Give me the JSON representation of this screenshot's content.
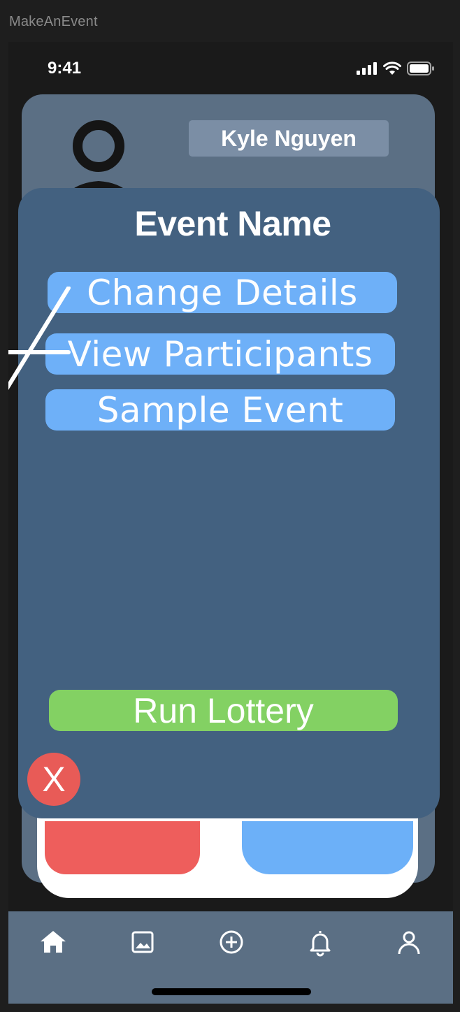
{
  "app": {
    "frame_title": "MakeAnEvent"
  },
  "status_bar": {
    "time": "9:41",
    "icons": [
      "cellular-signal-icon",
      "wifi-icon",
      "battery-icon"
    ]
  },
  "profile": {
    "name": "Kyle Nguyen"
  },
  "popup": {
    "title": "Event Name",
    "buttons": {
      "change_details": "Change Details",
      "view_participants": "View Participants",
      "sample_event": "Sample Event",
      "run_lottery": "Run Lottery"
    },
    "close_label": "X"
  },
  "tab_bar": {
    "items": [
      "home-icon",
      "gallery-icon",
      "add-circle-icon",
      "bell-icon",
      "profile-icon"
    ],
    "active": "home-icon"
  },
  "colors": {
    "background": "#1e1e1e",
    "card": "#5b6f84",
    "popup": "#436180",
    "menu_button": "#6eb0f8",
    "lottery_button": "#83d163",
    "close_button": "#e85b57",
    "name_badge": "#7b8ea5"
  }
}
